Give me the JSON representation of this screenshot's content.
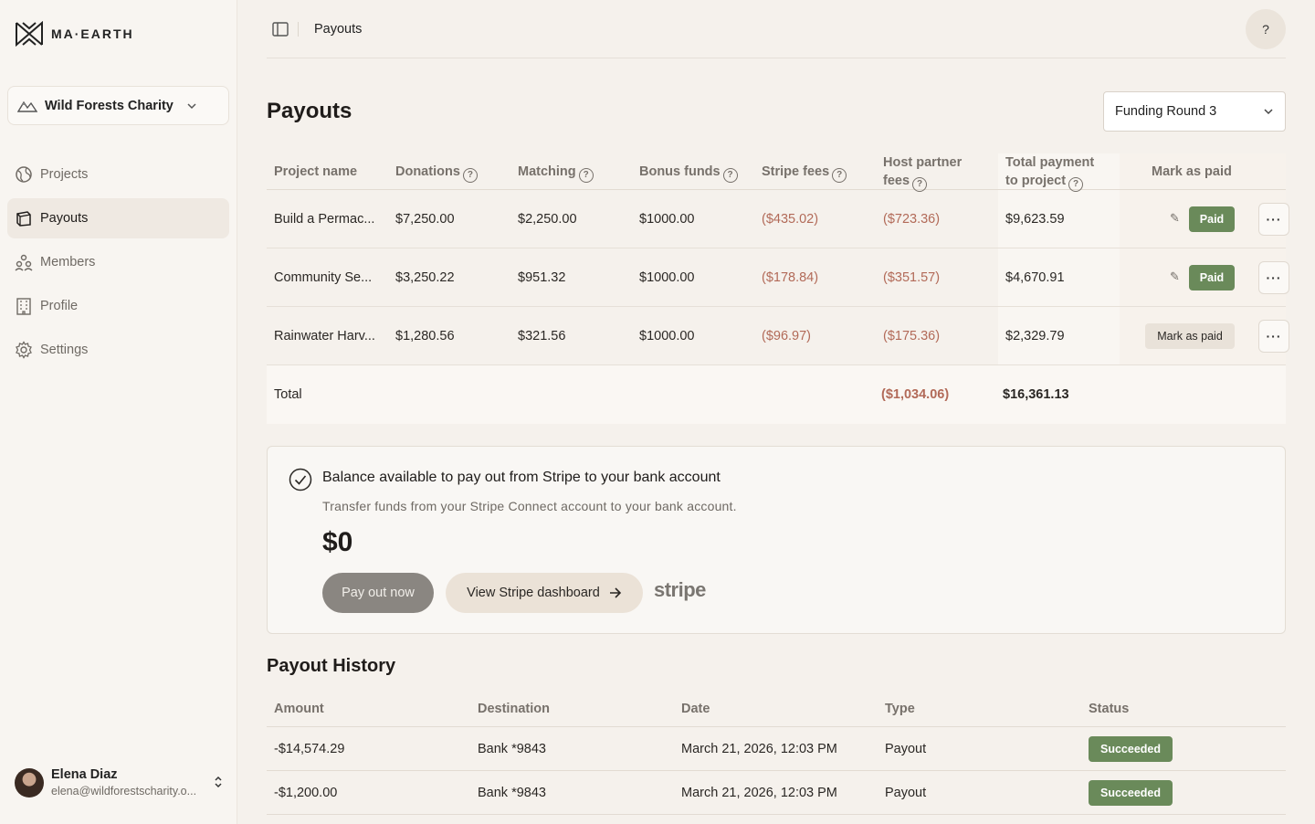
{
  "brand": {
    "name": "MA·EARTH"
  },
  "org": {
    "name": "Wild Forests Charity"
  },
  "nav": [
    {
      "label": "Projects",
      "icon": "globe-icon"
    },
    {
      "label": "Payouts",
      "icon": "payouts-icon"
    },
    {
      "label": "Members",
      "icon": "members-icon"
    },
    {
      "label": "Profile",
      "icon": "building-icon"
    },
    {
      "label": "Settings",
      "icon": "gear-icon"
    }
  ],
  "user": {
    "name": "Elena Diaz",
    "email": "elena@wildforestscharity.o..."
  },
  "topbar": {
    "breadcrumb": "Payouts",
    "help": "?"
  },
  "page": {
    "title": "Payouts",
    "round": "Funding Round 3"
  },
  "payouts": {
    "headers": {
      "project": "Project name",
      "donations": "Donations",
      "matching": "Matching",
      "bonus": "Bonus funds",
      "stripe": "Stripe fees",
      "host_1": "Host partner",
      "host_2": "fees",
      "total_1": "Total payment",
      "total_2": "to project",
      "mark": "Mark as paid"
    },
    "rows": [
      {
        "project": "Build a Permac...",
        "donations": "$7,250.00",
        "matching": "$2,250.00",
        "bonus": "$1000.00",
        "stripe": "($435.02)",
        "host": "($723.36)",
        "total": "$9,623.59",
        "status": "Paid"
      },
      {
        "project": "Community Se...",
        "donations": "$3,250.22",
        "matching": "$951.32",
        "bonus": "$1000.00",
        "stripe": "($178.84)",
        "host": "($351.57)",
        "total": "$4,670.91",
        "status": "Paid"
      },
      {
        "project": "Rainwater Harv...",
        "donations": "$1,280.56",
        "matching": "$321.56",
        "bonus": "$1000.00",
        "stripe": "($96.97)",
        "host": "($175.36)",
        "total": "$2,329.79",
        "status": "Mark as paid"
      }
    ],
    "total": {
      "label": "Total",
      "fees": "($1,034.06)",
      "amount": "$16,361.13"
    }
  },
  "balance": {
    "title": "Balance available to pay out from Stripe to your bank account",
    "subtitle": "Transfer funds from your Stripe Connect account to your bank account.",
    "amount": "$0",
    "pay_label": "Pay out now",
    "dashboard_label": "View Stripe dashboard",
    "stripe_logo": "stripe"
  },
  "history": {
    "title": "Payout History",
    "headers": {
      "amount": "Amount",
      "destination": "Destination",
      "date": "Date",
      "type": "Type",
      "status": "Status"
    },
    "rows": [
      {
        "amount": "-$14,574.29",
        "destination": "Bank *9843",
        "date": "March 21, 2026, 12:03 PM",
        "type": "Payout",
        "status": "Succeeded"
      },
      {
        "amount": "-$1,200.00",
        "destination": "Bank *9843",
        "date": "March 21, 2026, 12:03 PM",
        "type": "Payout",
        "status": "Succeeded"
      }
    ]
  },
  "colors": {
    "paid": "#6a8a5a",
    "negative": "#b26a58",
    "active_nav": "#efe9e2"
  }
}
